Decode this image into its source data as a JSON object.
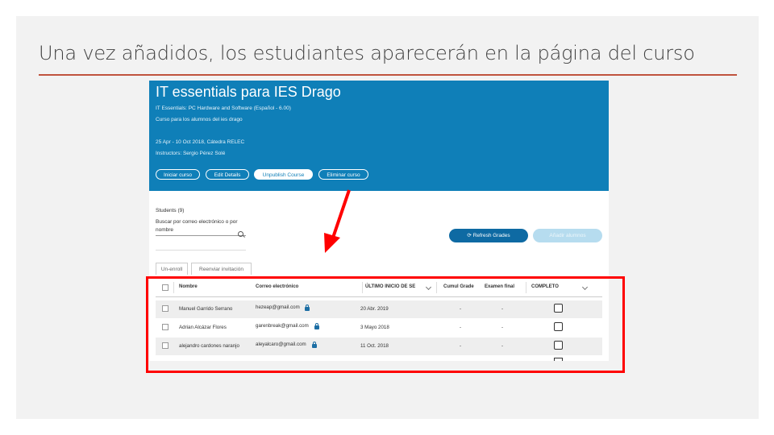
{
  "slide": {
    "title": "Una vez añadidos, los estudiantes aparecerán en la página del curso",
    "colors": {
      "rule": "#c0533e",
      "highlight": "#ff0000",
      "arrow": "#ff0000"
    }
  },
  "course": {
    "title": "IT essentials para IES Drago",
    "subtitle": "IT Essentials: PC Hardware and Software (Español - 6.00)",
    "description": "Curso para los alumnos del ies drago",
    "dates": "25 Apr - 10 Oct 2018, Cátedra RELEC",
    "instructors": "Instructors: Sergio Pérez Solé",
    "buttons": [
      "Iniciar curso",
      "Edit Details",
      "Unpublish Course",
      "Eliminar curso"
    ],
    "banner_color": "#0f7fb8"
  },
  "students": {
    "label": "Students (9)",
    "search_label": "Buscar por correo electrónico o por nombre",
    "refresh_button": "Refresh Grades",
    "add_button": "Añadir alumnos",
    "tabs": [
      "Un-enroll",
      "Reenviar invitación"
    ]
  },
  "table": {
    "headers": [
      "Nombre",
      "Correo electrónico",
      "ÚLTIMO INICIO DE SE",
      "Cumul Grade",
      "Examen final",
      "COMPLETO"
    ],
    "rows": [
      {
        "name": "Manuel Garrido Serrano",
        "email": "hezeap@gmail.com",
        "last_login": "20 Abr. 2019",
        "grade": "-",
        "final": "-"
      },
      {
        "name": "Adrian Alcázar Flores",
        "email": "garenbreak@gmail.com",
        "last_login": "3 Mayo 2018",
        "grade": "-",
        "final": "-"
      },
      {
        "name": "alejandro cardones naranjo",
        "email": "aleyalcaro@gmail.com",
        "last_login": "11 Oct. 2018",
        "grade": "-",
        "final": "-"
      }
    ]
  }
}
